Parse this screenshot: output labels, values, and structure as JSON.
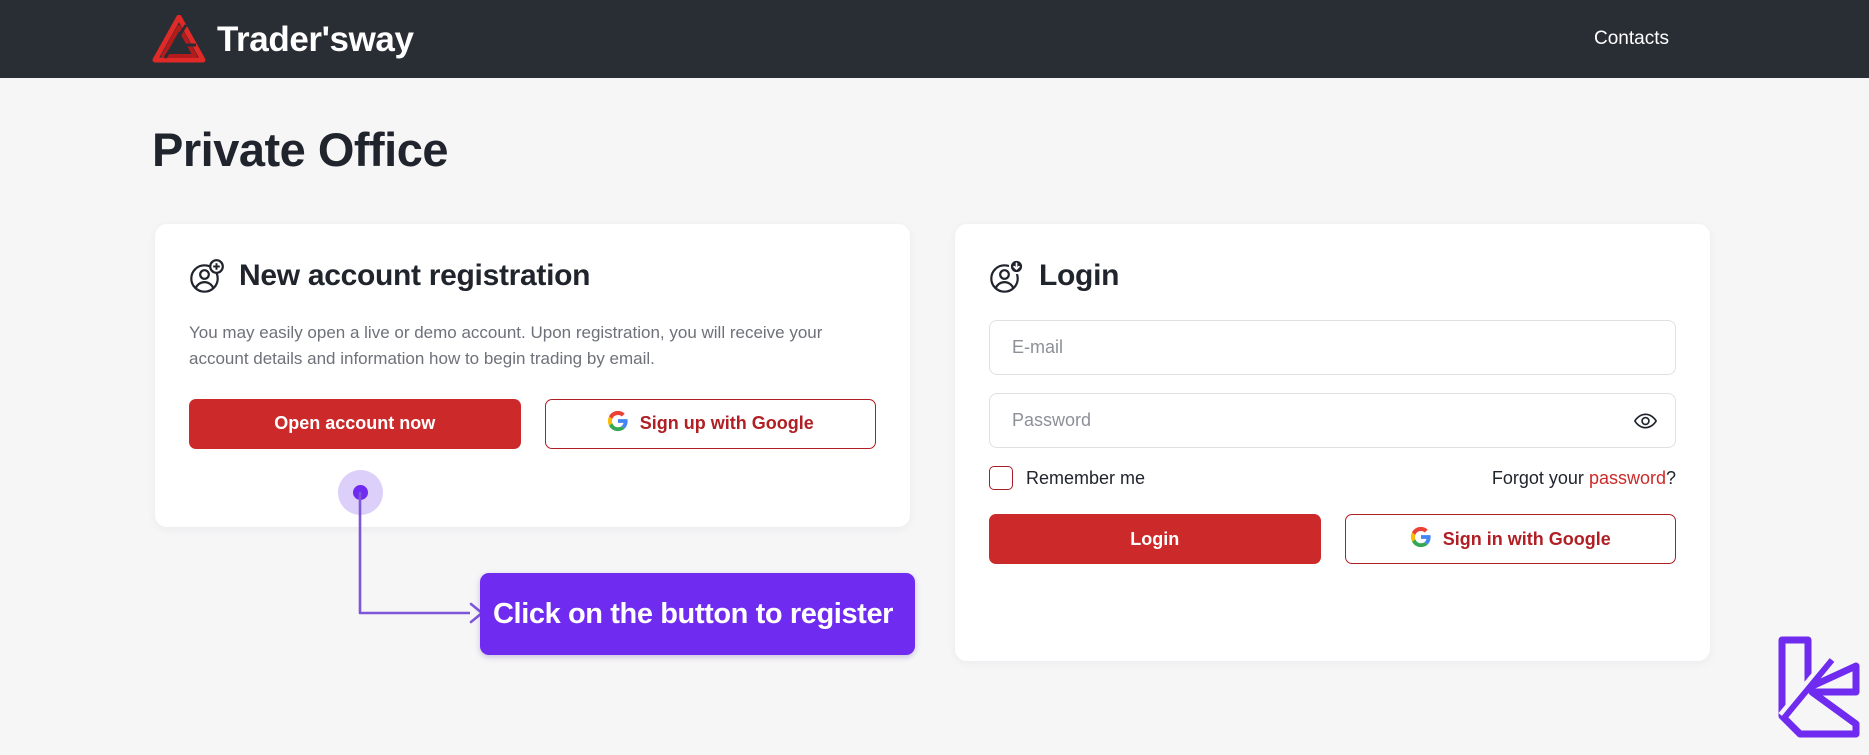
{
  "header": {
    "brand_name": "Trader'sway",
    "logo_icon": "penrose-triangle-logo",
    "nav": [
      {
        "label": "Contacts",
        "icon": ""
      }
    ]
  },
  "page": {
    "title": "Private Office"
  },
  "register_card": {
    "icon": "user-add-icon",
    "title": "New account registration",
    "description": "You may easily open a live or demo account. Upon registration, you will receive your account details and information how to begin trading by email.",
    "primary_button": "Open account now",
    "google_button": "Sign up with Google",
    "google_icon": "google-g-icon"
  },
  "login_card": {
    "icon": "user-login-icon",
    "title": "Login",
    "email_placeholder": "E-mail",
    "email_value": "",
    "password_placeholder": "Password",
    "password_value": "",
    "eye_icon": "eye-icon",
    "remember_label": "Remember me",
    "remember_checked": false,
    "forgot_prefix": "Forgot your ",
    "forgot_link": "password",
    "forgot_suffix": "?",
    "login_button": "Login",
    "google_button": "Sign in with Google",
    "google_icon": "google-g-icon"
  },
  "annotation": {
    "tooltip_text": "Click on the button to register",
    "marker_icon": "click-target-dot",
    "arrow_icon": "arrow-right-icon",
    "corner_icon": "le-monogram-logo"
  },
  "colors": {
    "header_bg": "#292d34",
    "page_bg": "#f6f6f7",
    "brand_red": "#cc2a2a",
    "outline_red": "#b01f24",
    "annotation_purple": "#6f2bef",
    "text_dark": "#20242c",
    "text_muted": "#6e7179"
  }
}
